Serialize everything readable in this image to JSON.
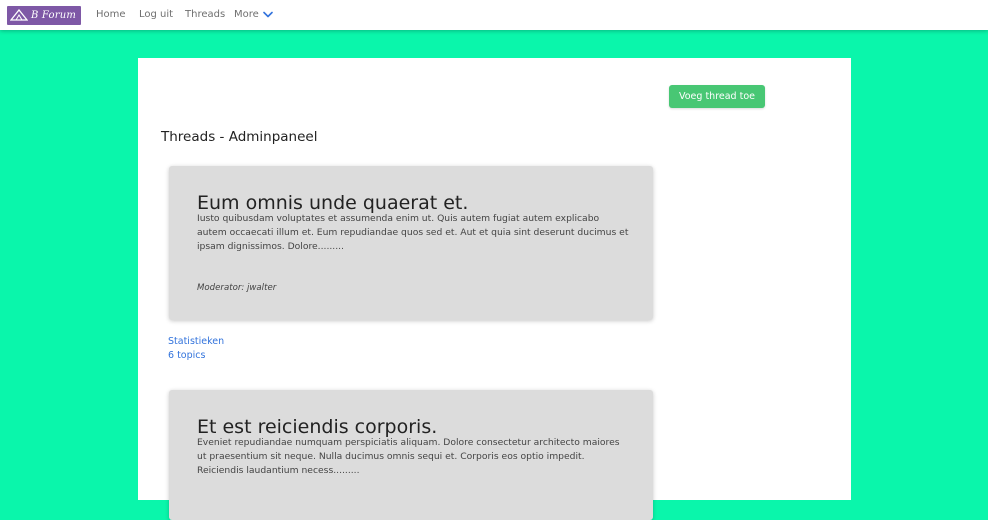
{
  "nav": {
    "logo_text": "B Forum",
    "links": [
      "Home",
      "Log uit",
      "Threads"
    ],
    "more_label": "More"
  },
  "panel": {
    "add_button_label": "Voeg thread toe",
    "page_title": "Threads - Adminpaneel"
  },
  "threads": [
    {
      "title": "Eum omnis unde quaerat et.",
      "excerpt": "Iusto quibusdam voluptates et assumenda enim ut. Quis autem fugiat autem explicabo autem occaecati illum et. Eum repudiandae quos sed et. Aut et quia sint deserunt ducimus et ipsam dignissimos. Dolore.........",
      "moderator": "Moderator: jwalter",
      "stats_label": "Statistieken",
      "topics_label": "6 topics"
    },
    {
      "title": "Et est reiciendis corporis.",
      "excerpt": "Eveniet repudiandae numquam perspiciatis aliquam. Dolore consectetur architecto maiores ut praesentium sit neque. Nulla ducimus omnis sequi et. Corporis eos optio impedit. Reiciendis laudantium necess.........",
      "moderator": "",
      "stats_label": "",
      "topics_label": ""
    }
  ],
  "colors": {
    "background": "#0af6ab",
    "logo_bg": "#7e58a6",
    "button": "#48c774",
    "link": "#3273dc",
    "card": "#dcdcdc"
  },
  "icons": {
    "logo": "forum-logo-icon",
    "more": "chevron-down-icon"
  }
}
